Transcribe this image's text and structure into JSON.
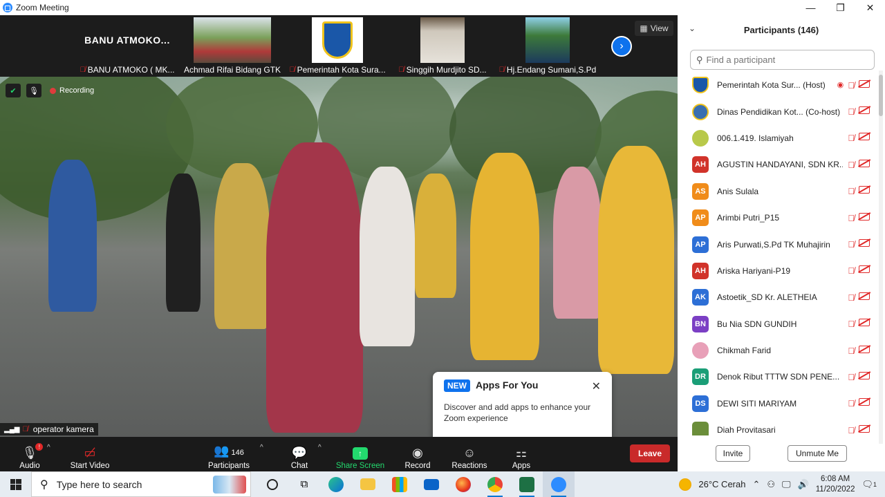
{
  "window": {
    "title": "Zoom Meeting",
    "minimize": "—",
    "maximize": "❐",
    "close": "✕"
  },
  "strip": {
    "tiles": [
      {
        "big": "BANU ATMOKO...",
        "name": "BANU ATMOKO ( MK...",
        "muted": true
      },
      {
        "name": "Achmad Rifai Bidang GTK",
        "muted": false
      },
      {
        "name": "Pemerintah Kota Sura...",
        "muted": true
      },
      {
        "name": "Singgih Murdjito SD...",
        "muted": true
      },
      {
        "name": "Hj.Endang Sumani,S.Pd",
        "muted": true
      }
    ],
    "view_label": "View"
  },
  "main_video": {
    "recording_label": "Recording",
    "speaker_name": "operator kamera"
  },
  "popup": {
    "badge": "NEW",
    "title": "Apps For You",
    "body": "Discover and add apps to enhance your Zoom experience"
  },
  "toolbar": {
    "audio": "Audio",
    "start_video": "Start Video",
    "participants": "Participants",
    "participants_count": "146",
    "chat": "Chat",
    "share_screen": "Share Screen",
    "record": "Record",
    "reactions": "Reactions",
    "apps": "Apps",
    "leave": "Leave"
  },
  "panel": {
    "title": "Participants (146)",
    "search_placeholder": "Find a participant",
    "participants": [
      {
        "name": "Pemerintah Kota Sur... (Host)",
        "initials": "",
        "color": "#1a57a8"
      },
      {
        "name": "Dinas Pendidikan Kot... (Co-host)",
        "initials": "",
        "color": "#3a6fb0"
      },
      {
        "name": "006.1.419. Islamiyah",
        "initials": "",
        "color": "#b8c94a"
      },
      {
        "name": "AGUSTIN HANDAYANI, SDN KR...",
        "initials": "AH",
        "color": "#d1332a"
      },
      {
        "name": "Anis Sulala",
        "initials": "AS",
        "color": "#f08c1a"
      },
      {
        "name": "Arimbi Putri_P15",
        "initials": "AP",
        "color": "#f08c1a"
      },
      {
        "name": "Aris Purwati,S.Pd TK Muhajirin",
        "initials": "AP",
        "color": "#2d6fd6"
      },
      {
        "name": "Ariska Hariyani-P19",
        "initials": "AH",
        "color": "#d1332a"
      },
      {
        "name": "Astoetik_SD Kr. ALETHEIA",
        "initials": "AK",
        "color": "#2d6fd6"
      },
      {
        "name": "Bu Nia SDN GUNDIH",
        "initials": "BN",
        "color": "#7b3fc4"
      },
      {
        "name": "Chikmah Farid",
        "initials": "",
        "color": "#e8a0b8"
      },
      {
        "name": "Denok Ribut TTTW  SDN PENE...",
        "initials": "DR",
        "color": "#1a9e77"
      },
      {
        "name": "DEWI SITI MARIYAM",
        "initials": "DS",
        "color": "#2d6fd6"
      },
      {
        "name": "Diah Provitasari",
        "initials": "",
        "color": "#6b8e3a"
      }
    ],
    "invite": "Invite",
    "unmute_me": "Unmute Me"
  },
  "taskbar": {
    "search_placeholder": "Type here to search",
    "weather": "26°C  Cerah",
    "time": "6:08 AM",
    "date": "11/20/2022",
    "notifications": "1"
  }
}
